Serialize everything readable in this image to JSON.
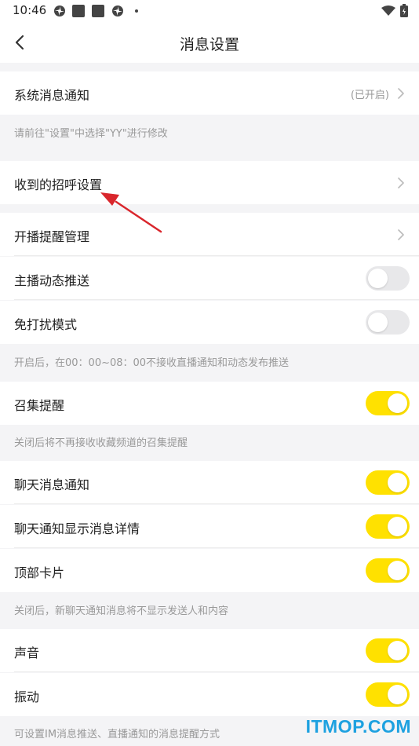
{
  "status_bar": {
    "time": "10:46",
    "icons": [
      "pinwheel-icon",
      "square-icon",
      "square-icon",
      "pinwheel-icon",
      "dot-icon"
    ],
    "right_icons": [
      "wifi-icon",
      "battery-icon"
    ]
  },
  "nav": {
    "title": "消息设置",
    "back_icon": "chevron-left-icon"
  },
  "rows": {
    "system_notify": {
      "label": "系统消息通知",
      "status": "(已开启)"
    },
    "greeting": {
      "label": "收到的招呼设置"
    },
    "live_reminder": {
      "label": "开播提醒管理"
    },
    "anchor_feed": {
      "label": "主播动态推送",
      "on": false
    },
    "dnd_mode": {
      "label": "免打扰模式",
      "on": false
    },
    "gather": {
      "label": "召集提醒",
      "on": true
    },
    "chat_notify": {
      "label": "聊天消息通知",
      "on": true
    },
    "chat_detail": {
      "label": "聊天通知显示消息详情",
      "on": true
    },
    "top_card": {
      "label": "顶部卡片",
      "on": true
    },
    "sound": {
      "label": "声音",
      "on": true
    },
    "vibrate": {
      "label": "振动",
      "on": true
    }
  },
  "hints": {
    "system": "请前往\"设置\"中选择\"YY\"进行修改",
    "dnd": "开启后，在00：00~08：00不接收直播通知和动态发布推送",
    "gather": "关闭后将不再接收收藏频道的召集提醒",
    "chat": "关闭后，新聊天通知消息将不显示发送人和内容",
    "sound": "可设置IM消息推送、直播通知的消息提醒方式"
  },
  "watermark": "ITMOP.COM",
  "colors": {
    "toggle_on": "#ffe100",
    "toggle_off": "#e8e8ea",
    "annotation_arrow": "#d9262c",
    "watermark": "#1da1e0"
  }
}
